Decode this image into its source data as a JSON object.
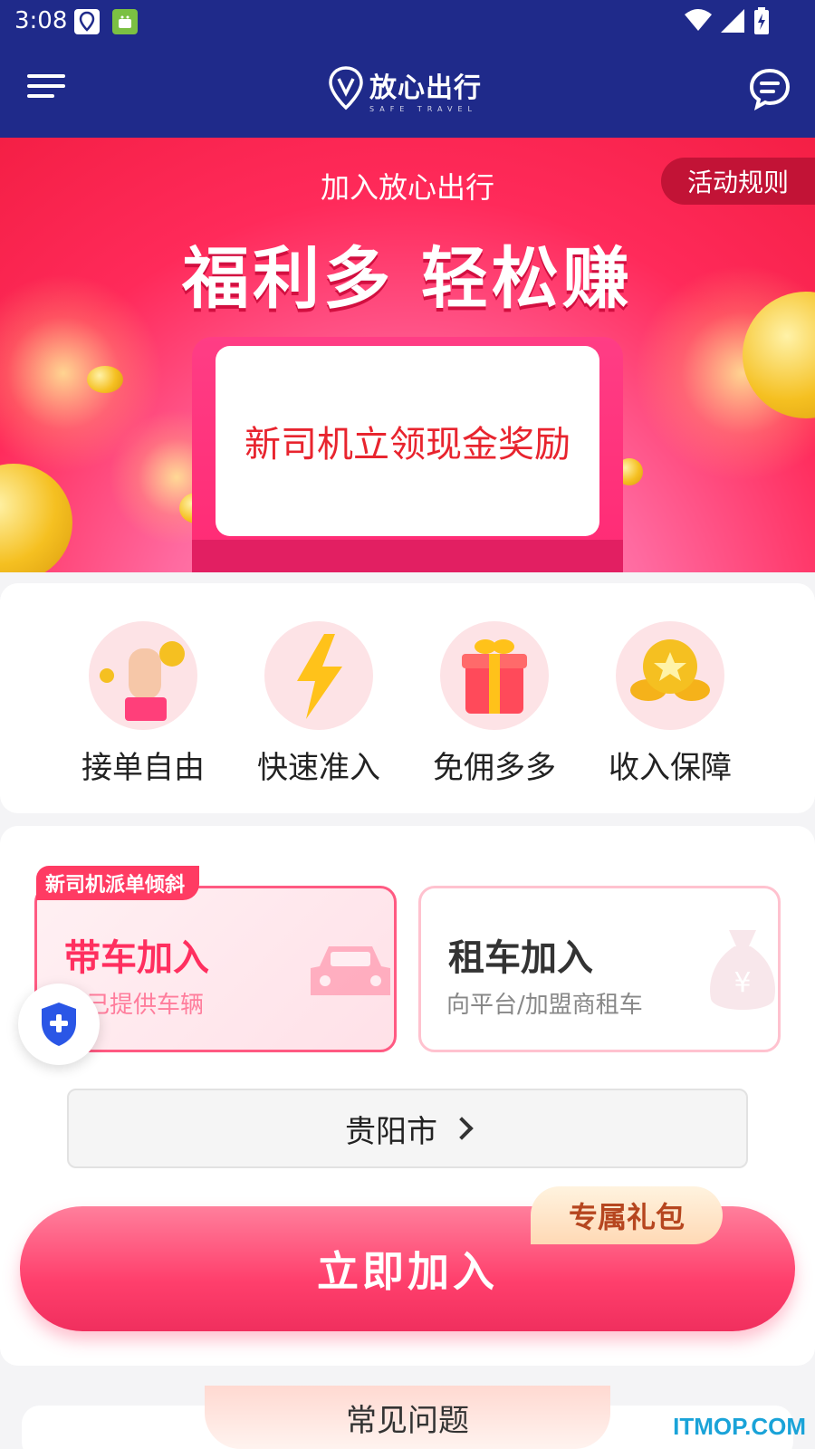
{
  "status_bar": {
    "time": "3:08"
  },
  "nav": {
    "brand": "放心出行",
    "brand_en": "SAFE TRAVEL"
  },
  "banner": {
    "join_title": "加入放心出行",
    "rules_button": "活动规则",
    "headline": "福利多 轻松赚",
    "card_text": "新司机立领现金奖励"
  },
  "features": [
    {
      "label": "接单自由",
      "icon": "hand-coin-icon"
    },
    {
      "label": "快速准入",
      "icon": "lightning-icon"
    },
    {
      "label": "免佣多多",
      "icon": "gift-box-icon"
    },
    {
      "label": "收入保障",
      "icon": "coin-stack-icon"
    }
  ],
  "join_options": {
    "tag": "新司机派单倾斜",
    "own": {
      "title": "带车加入",
      "subtitle": "自己提供车辆"
    },
    "rent": {
      "title": "租车加入",
      "subtitle": "向平台/加盟商租车"
    }
  },
  "city": "贵阳市",
  "join_button": "立即加入",
  "gift_tag": "专属礼包",
  "faq_title": "常见问题",
  "watermark": "ITMOP.COM",
  "colors": {
    "header_bg": "#1f2a8a",
    "accent": "#ff3f6c",
    "banner_red": "#f41f45"
  }
}
